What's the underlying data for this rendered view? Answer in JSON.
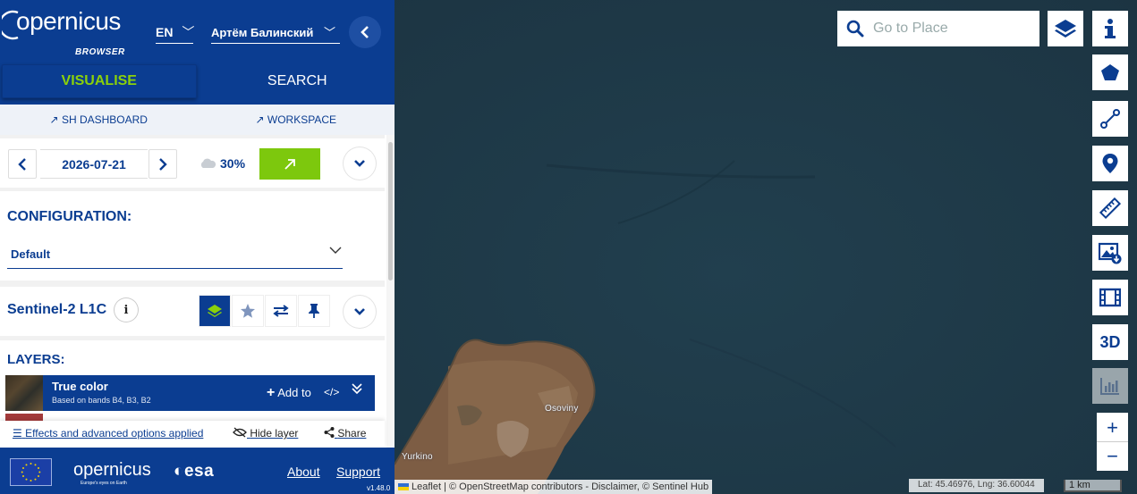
{
  "app": {
    "logo_text": "opernicus",
    "logo_subtitle": "BROWSER",
    "language": "EN",
    "user_name": "Артём Балинский",
    "collapse_icon": "chevron-left-icon"
  },
  "tabs": [
    {
      "label": "VISUALISE",
      "active": true
    },
    {
      "label": "SEARCH",
      "active": false
    }
  ],
  "links": {
    "dashboard": "SH DASHBOARD",
    "workspace": "WORKSPACE"
  },
  "date_row": {
    "date": "2026-07-21",
    "cloud_coverage": "30%"
  },
  "configuration": {
    "title": "CONFIGURATION:",
    "selected": "Default"
  },
  "dataset": {
    "name": "Sentinel-2 L1C",
    "info_glyph": "i"
  },
  "layers": {
    "title": "LAYERS:",
    "items": [
      {
        "title": "True color",
        "description": "Based on bands B4, B3, B2",
        "add_to_label": "Add to",
        "code_glyph": "</>"
      }
    ]
  },
  "layer_footer": {
    "effects": "Effects and advanced options applied",
    "hide": "Hide layer",
    "share": "Share"
  },
  "footer": {
    "logo_text": "opernicus",
    "logo_tagline": "Europe's eyes on Earth",
    "esa": "esa",
    "about": "About",
    "support": "Support",
    "version": "v1.48.0"
  },
  "map": {
    "search_placeholder": "Go to Place",
    "tools": [
      "info-icon",
      "polygon-icon",
      "line-icon",
      "marker-icon",
      "ruler-icon",
      "image-download-icon",
      "timelapse-icon",
      "3d-icon",
      "histogram-icon"
    ],
    "tool_3d_label": "3D",
    "zoom_in": "+",
    "zoom_out": "−",
    "place_labels": [
      "Osoviny",
      "Yurkino"
    ],
    "attribution": "Leaflet | © OpenStreetMap contributors - Disclaimer, © Sentinel Hub",
    "latlng": "Lat: 45.46976, Lng: 36.60044",
    "scale": "1 km"
  },
  "colors": {
    "brand": "#0b3d91",
    "accent": "#7dc80d",
    "sea": "#1f3a48"
  }
}
